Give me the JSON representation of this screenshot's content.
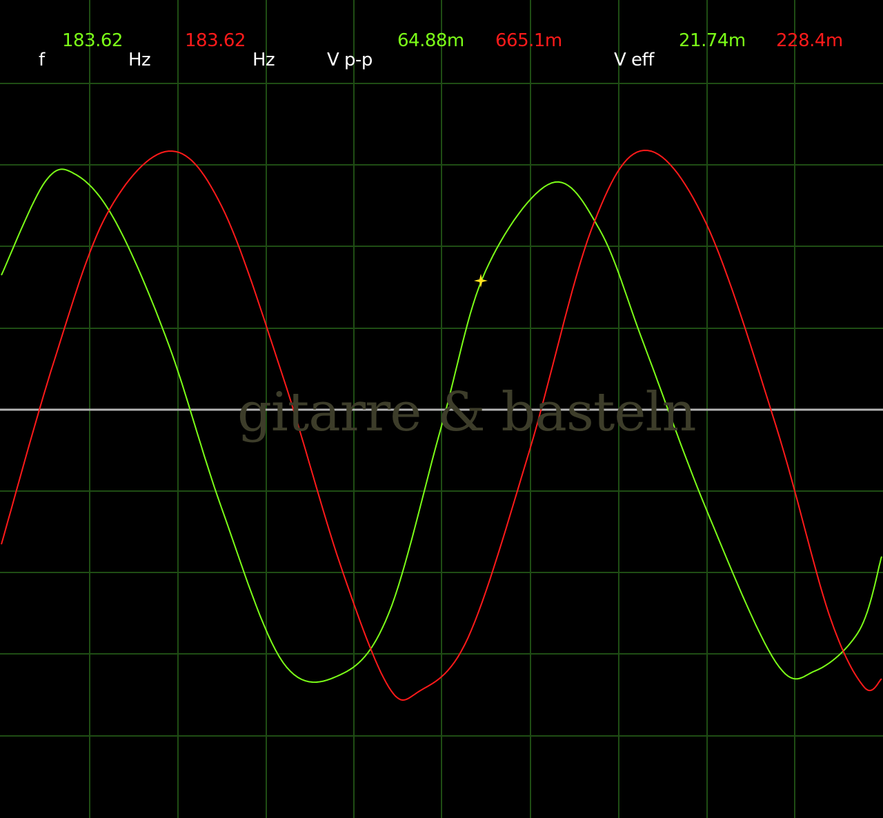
{
  "readouts": {
    "f_label": "f",
    "hz_label_1": "Hz",
    "hz_label_2": "Hz",
    "vpp_label": "V p-p",
    "veff_label": "V eff",
    "ch1_freq": "183.62",
    "ch2_freq": "183.62",
    "ch1_vpp": "64.88m",
    "ch2_vpp": "665.1m",
    "ch1_veff": "21.74m",
    "ch2_veff": "228.4m"
  },
  "watermark": "gitarre & basteln",
  "colors": {
    "background": "#000000",
    "grid": "#1f4d14",
    "zero_line": "#b4b4b4",
    "channel_1": "#7cff18",
    "channel_2": "#ff1a1a",
    "cursor": "#ffe020"
  },
  "chart_data": {
    "type": "line",
    "title": "",
    "xlabel": "",
    "ylabel": "",
    "grid": true,
    "grid_divisions": {
      "x": 10,
      "y": 10
    },
    "xlim": [
      0,
      10
    ],
    "ylim": [
      -5,
      5
    ],
    "series": [
      {
        "color": "#7cff18",
        "x": [
          0,
          0.5,
          0.85,
          1.3,
          1.9,
          2.5,
          3.2,
          3.85,
          4.4,
          5.0,
          5.5,
          6.25,
          6.8,
          7.3,
          8.0,
          8.8,
          9.25,
          9.75,
          10.0
        ],
        "y": [
          1.65,
          2.8,
          2.88,
          2.3,
          0.8,
          -1.2,
          -3.1,
          -3.25,
          -2.5,
          -0.2,
          1.7,
          2.78,
          2.2,
          0.8,
          -1.2,
          -3.1,
          -3.2,
          -2.7,
          -1.8
        ]
      },
      {
        "color": "#ff1a1a",
        "x": [
          0,
          0.6,
          1.2,
          1.9,
          2.5,
          3.2,
          3.85,
          4.4,
          4.75,
          5.3,
          6.0,
          6.7,
          7.3,
          8.0,
          8.8,
          9.4,
          9.8,
          10.0
        ],
        "y": [
          -1.65,
          0.6,
          2.4,
          3.17,
          2.5,
          0.4,
          -1.9,
          -3.4,
          -3.45,
          -2.8,
          -0.5,
          2.2,
          3.18,
          2.3,
          -0.2,
          -2.5,
          -3.4,
          -3.3
        ]
      }
    ]
  }
}
